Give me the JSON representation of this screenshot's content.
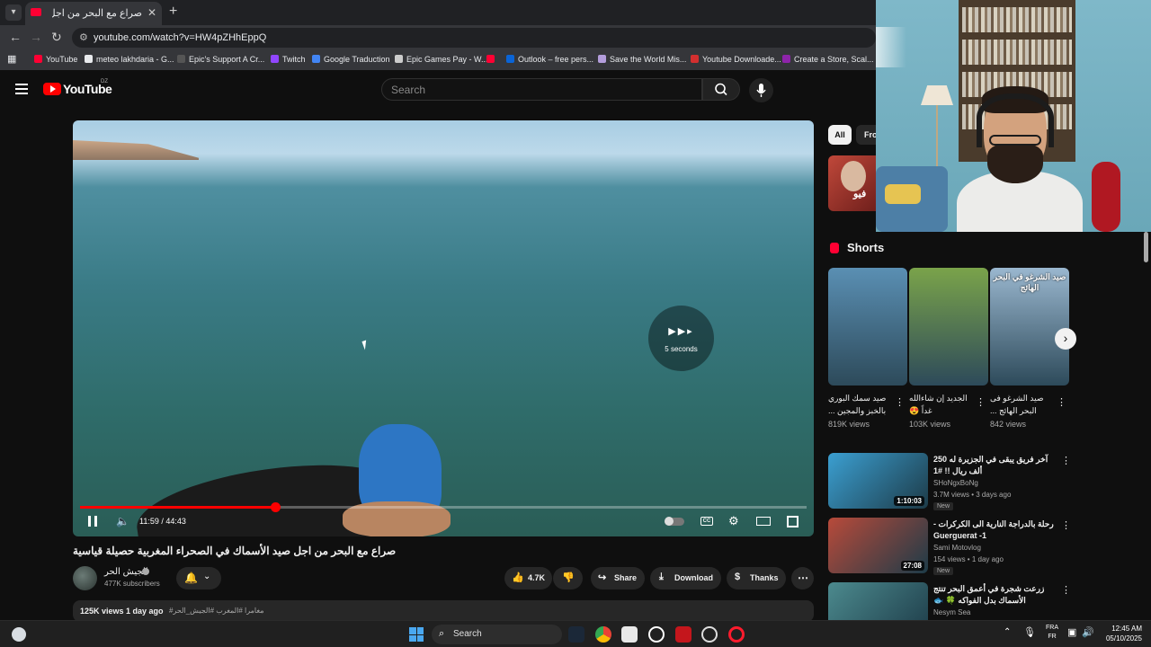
{
  "browser": {
    "tab_title": "صراع مع البحر من اجل صيد",
    "url": "youtube.com/watch?v=HW4pZHhEppQ",
    "bookmarks": [
      {
        "label": "YouTube",
        "color": "#ff0033"
      },
      {
        "label": "meteo lakhdaria - G...",
        "color": "#e8eaed"
      },
      {
        "label": "Epic's Support A Cr...",
        "color": "#555555"
      },
      {
        "label": "Twitch",
        "color": "#9146ff"
      },
      {
        "label": "Google Traduction",
        "color": "#4285f4"
      },
      {
        "label": "Epic Games Pay - W...",
        "color": "#cccccc"
      },
      {
        "label": "",
        "color": "#ff0033"
      },
      {
        "label": "Outlook – free pers...",
        "color": "#0a64d6"
      },
      {
        "label": "Save the World Mis...",
        "color": "#b39ddb"
      },
      {
        "label": "Youtube Downloade...",
        "color": "#d32f2f"
      },
      {
        "label": "Create a Store, Scal...",
        "color": "#8e24aa"
      }
    ]
  },
  "header": {
    "logo_text": "YouTube",
    "region": "DZ",
    "search_placeholder": "Search"
  },
  "player": {
    "time_display": "11:59 / 44:43",
    "progress": 0.268,
    "skip_label": "5 seconds",
    "cc_label": "CC"
  },
  "video": {
    "title": "صراع مع البحر من اجل صيد الأسماك في الصحراء المغربية حصيلة قياسية",
    "channel": "الجيش الحر",
    "subscribers": "477K subscribers",
    "likes": "4.7K",
    "share_label": "Share",
    "download_label": "Download",
    "thanks_label": "Thanks",
    "views_date": "125K views  1 day ago",
    "hashtags": "#مغامرا #المغرب #الجيش_الحر"
  },
  "sidebar": {
    "chips": [
      "All",
      "Fro"
    ],
    "ad_text": "فيو",
    "shorts_title": "Shorts",
    "shorts": [
      {
        "overlay": "",
        "title": "صيد سمك البوري بالخبز والمجين ...",
        "views": "819K views",
        "bg": "#5a8fb3"
      },
      {
        "overlay": "",
        "title": "الجديد إن شاءالله غداً 😍",
        "views": "103K views",
        "bg": "#7aa34a"
      },
      {
        "overlay": "صيد الشرغو في البحر الهائج",
        "title": "صيد الشرغو فى البحر الهائج ...",
        "views": "842 views",
        "bg": "#9ab7cf"
      }
    ],
    "recommended": [
      {
        "title": "آخر فريق يبقى في الجزيرة له 250 ألف ريال !! #1",
        "channel": "SHoNgxBoNg",
        "meta": "3.7M views • 3 days ago",
        "badge": "New",
        "duration": "1:10:03",
        "bg": "#3b9fd1"
      },
      {
        "title": "رحلة بالدراجة النارية الى الكركرات - Guerguerat -1",
        "channel": "Sami Motovlog",
        "meta": "154 views • 1 day ago",
        "badge": "New",
        "duration": "27:08",
        "bg": "#b84a3a"
      },
      {
        "title": "زرعت شجرة في أعمق البحر تنتج الأسماك بدل الفواكه 🍀 🐟",
        "channel": "Nesym Sea",
        "meta": "",
        "badge": "",
        "duration": "",
        "bg": "#4c8a8e"
      }
    ]
  },
  "taskbar": {
    "search_label": "Search",
    "lang_top": "FRA",
    "lang_bottom": "FR",
    "time": "12:45 AM",
    "date": "05/10/2025"
  }
}
